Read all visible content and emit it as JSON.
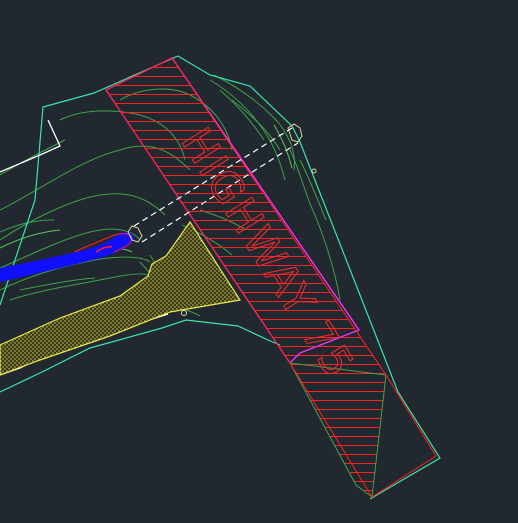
{
  "drawing": {
    "background": "#212830",
    "labels": {
      "highway": "HIGHWAY 75"
    },
    "colors": {
      "boundary": "#39e6a6",
      "contour": "#3fa24a",
      "contour_bright": "#59c95a",
      "right_of_way": "#ff33ff",
      "hatch": "#ff2020",
      "fill_zone_edge": "#e8e84a",
      "fill_zone_fill": "#9c9c2e",
      "water": "#1010ff",
      "water_edge": "#ff2020",
      "white_line": "#ffffff",
      "crossing": "#ffffff"
    }
  }
}
